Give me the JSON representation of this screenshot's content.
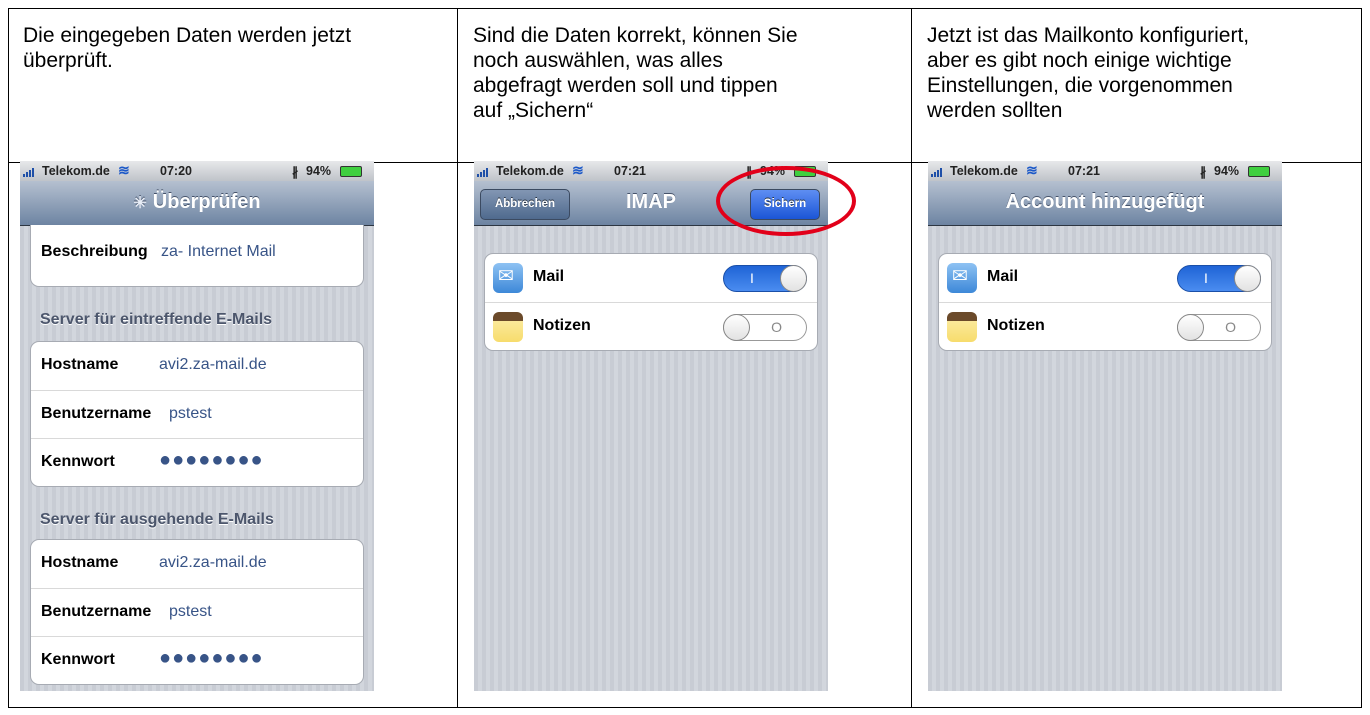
{
  "header": {
    "col1": [
      "Die eingegeben Daten werden jetzt",
      "überprüft."
    ],
    "col2": [
      "Sind die Daten korrekt, können Sie",
      "noch auswählen, was alles",
      "abgefragt werden soll und tippen",
      "auf „Sichern“"
    ],
    "col3": [
      "Jetzt ist das Mailkonto konfiguriert,",
      "aber es gibt noch einige wichtige",
      "Einstellungen, die vorgenommen",
      "werden sollten"
    ]
  },
  "phone1": {
    "status": {
      "carrier": "Telekom.de",
      "time": "07:20",
      "battery": "94%"
    },
    "nav_title": "Überprüfen",
    "description": {
      "label": "Beschreibung",
      "value": "za- Internet Mail"
    },
    "incoming_header": "Server für eintreffende E-Mails",
    "incoming": [
      {
        "label": "Hostname",
        "value": "avi2.za-mail.de"
      },
      {
        "label": "Benutzername",
        "value": "pstest"
      },
      {
        "label": "Kennwort",
        "value": "●●●●●●●●"
      }
    ],
    "outgoing_header": "Server für ausgehende E-Mails",
    "outgoing": [
      {
        "label": "Hostname",
        "value": "avi2.za-mail.de"
      },
      {
        "label": "Benutzername",
        "value": "pstest"
      },
      {
        "label": "Kennwort",
        "value": "●●●●●●●●"
      }
    ]
  },
  "phone2": {
    "status": {
      "carrier": "Telekom.de",
      "time": "07:21",
      "battery": "94%"
    },
    "cancel_label": "Abbrechen",
    "nav_title": "IMAP",
    "save_label": "Sichern",
    "rows": [
      {
        "label": "Mail",
        "state": "I",
        "icon": "mail-icon"
      },
      {
        "label": "Notizen",
        "state": "O",
        "icon": "notes-icon"
      }
    ]
  },
  "phone3": {
    "status": {
      "carrier": "Telekom.de",
      "time": "07:21",
      "battery": "94%"
    },
    "nav_title": "Account hinzugefügt",
    "rows": [
      {
        "label": "Mail",
        "state": "I",
        "icon": "mail-icon"
      },
      {
        "label": "Notizen",
        "state": "O",
        "icon": "notes-icon"
      }
    ]
  },
  "colors": {
    "highlight_circle": "#e2001a",
    "navbar": "#6d84a2",
    "save_button": "#1b55d6"
  }
}
